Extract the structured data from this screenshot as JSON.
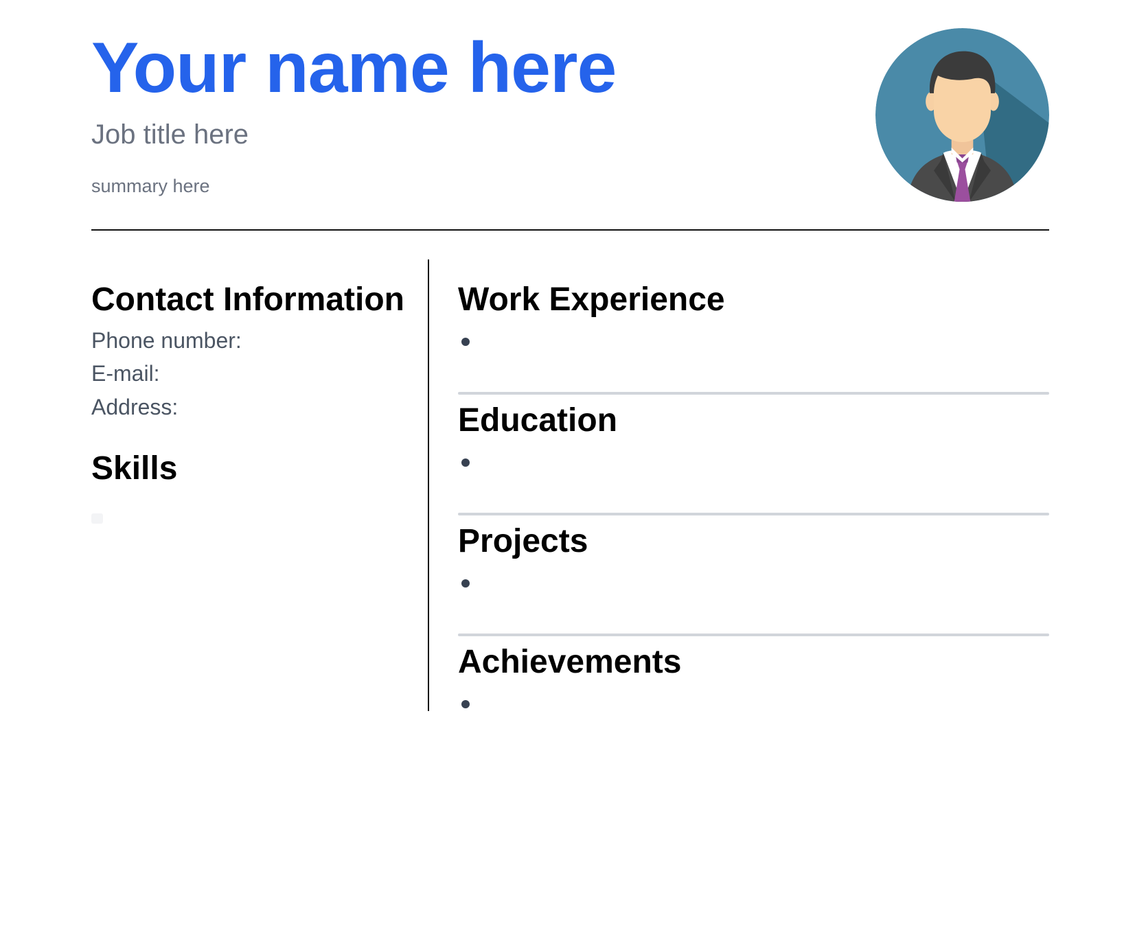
{
  "header": {
    "name": "Your name here",
    "job_title": "Job title here",
    "summary": "summary here",
    "avatar_icon": "person-avatar-icon",
    "accent_color": "#2563eb"
  },
  "left_column": {
    "contact_heading": "Contact Information",
    "contact_fields": [
      {
        "label": "Phone number:"
      },
      {
        "label": "E-mail:"
      },
      {
        "label": "Address:"
      }
    ],
    "skills_heading": "Skills"
  },
  "right_column": {
    "sections": [
      {
        "heading": "Work Experience"
      },
      {
        "heading": "Education"
      },
      {
        "heading": "Projects"
      },
      {
        "heading": "Achievements"
      }
    ]
  }
}
